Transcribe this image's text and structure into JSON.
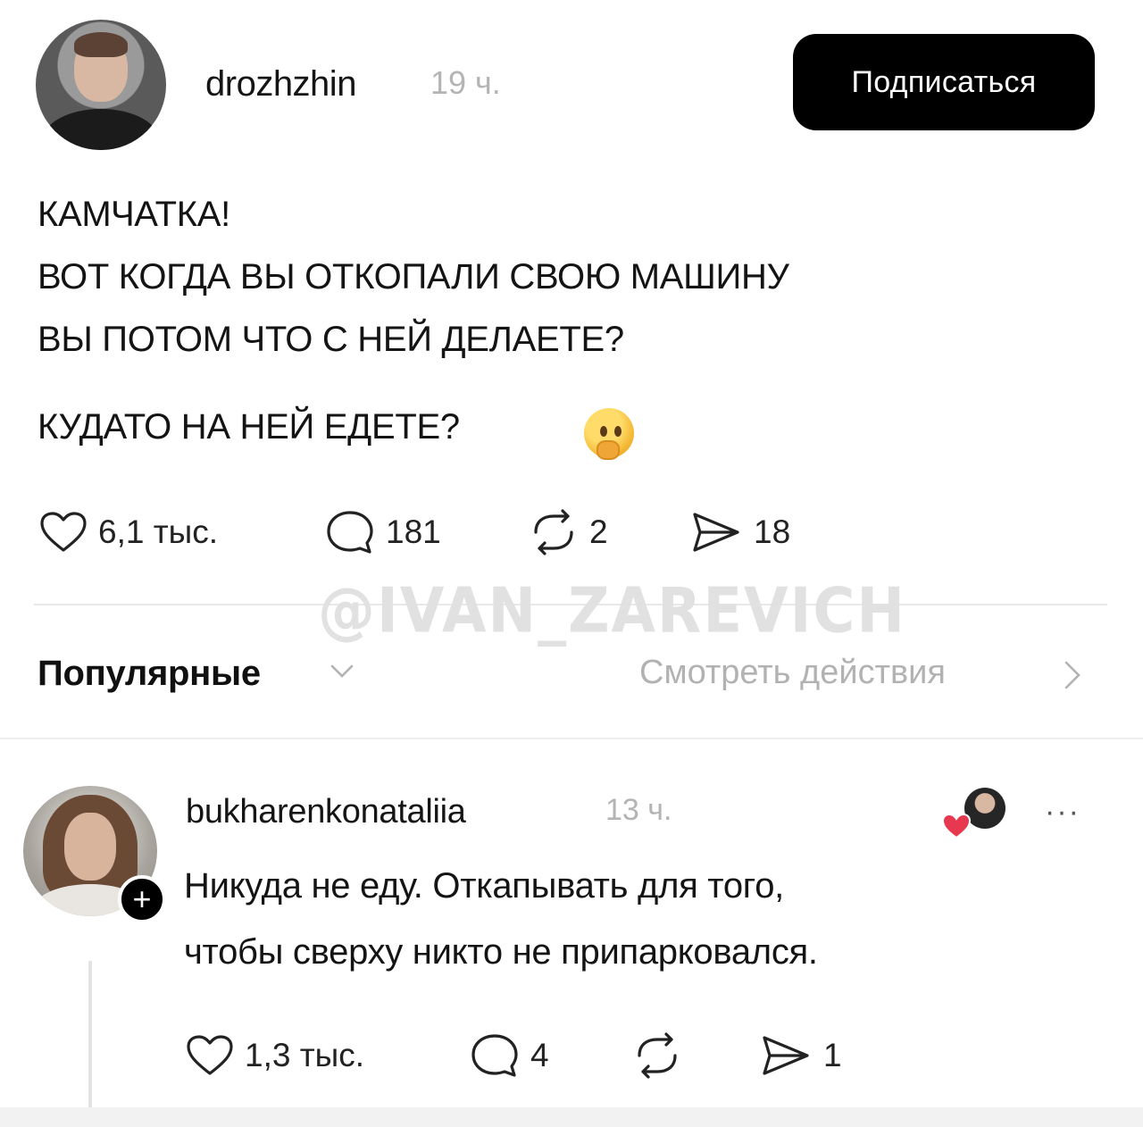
{
  "post": {
    "username": "drozhzhin",
    "time": "19 ч.",
    "follow_label": "Подписаться",
    "lines": [
      "КАМЧАТКА!",
      "ВОТ КОГДА ВЫ ОТКОПАЛИ СВОЮ МАШИНУ",
      "ВЫ ПОТОМ ЧТО С НЕЙ ДЕЛАЕТЕ?",
      "КУДАТО НА НЕЙ ЕДЕТЕ?"
    ],
    "emoji_icon": "thinking-face",
    "likes": "6,1 тыс.",
    "comments": "181",
    "reposts": "2",
    "shares": "18"
  },
  "watermark": "@IVAN_ZAREVICH",
  "sort": {
    "label": "Популярные",
    "see_actions": "Смотреть действия"
  },
  "comment": {
    "username": "bukharenkonataliia",
    "time": "13 ч.",
    "lines": [
      "Никуда не еду. Откапывать для того,",
      "чтобы сверху никто не припарковался."
    ],
    "likes": "1,3 тыс.",
    "comments": "4",
    "shares": "1",
    "more": "···",
    "plus": "+"
  },
  "colors": {
    "follow_bg": "#000000",
    "muted_text": "#b4b4b4",
    "heart": "#e63950"
  }
}
